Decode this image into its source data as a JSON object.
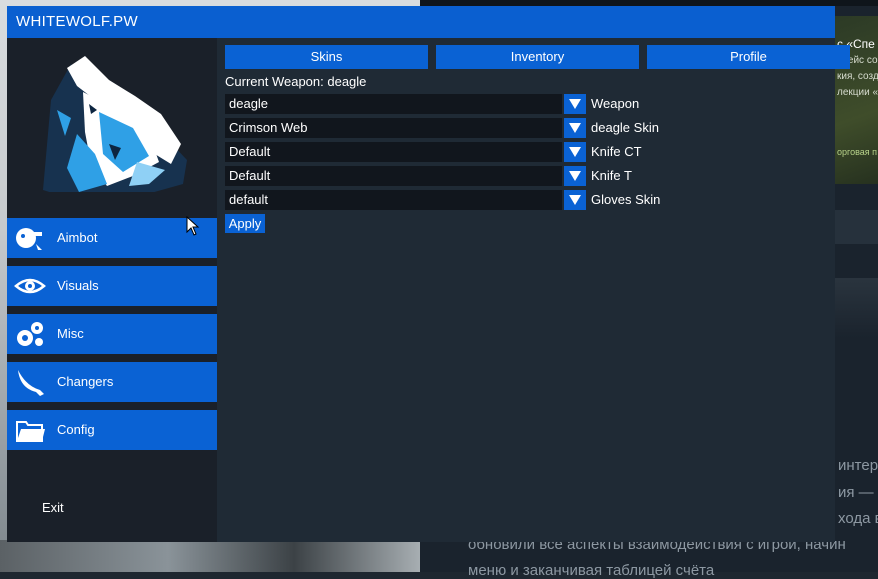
{
  "window": {
    "title": "WHITEWOLF.PW"
  },
  "sidebar": {
    "items": [
      {
        "label": "Aimbot",
        "icon": "aimbot-icon"
      },
      {
        "label": "Visuals",
        "icon": "eye-icon"
      },
      {
        "label": "Misc",
        "icon": "gears-icon"
      },
      {
        "label": "Changers",
        "icon": "knife-icon"
      },
      {
        "label": "Config",
        "icon": "folder-icon"
      }
    ],
    "exit_label": "Exit"
  },
  "tabs": [
    {
      "label": "Skins"
    },
    {
      "label": "Inventory"
    },
    {
      "label": "Profile"
    }
  ],
  "skins": {
    "current_weapon": "Current Weapon: deagle",
    "rows": [
      {
        "value": "deagle",
        "label": "Weapon"
      },
      {
        "value": "Crimson Web",
        "label": "deagle Skin"
      },
      {
        "value": "Default",
        "label": "Knife CT"
      },
      {
        "value": "Default",
        "label": "Knife T"
      },
      {
        "value": "default",
        "label": "Gloves Skin"
      }
    ],
    "apply_label": "Apply"
  },
  "background": {
    "banner_lines": [
      "с «Спе",
      "г кейс со",
      "кия, созд",
      "лекции «",
      "орговая п"
    ],
    "text_lines": [
      "интере",
      "ия — н",
      "хода в",
      "обновили все аспекты взаимодействия с игрой, начин",
      "меню и заканчивая таблицей счёта"
    ]
  },
  "colors": {
    "accent": "#0a62d4",
    "titlebar": "#0a5fd0",
    "sidebar_bg": "#1a2029",
    "content_bg": "#1f2a35",
    "field_bg": "#11161d"
  }
}
